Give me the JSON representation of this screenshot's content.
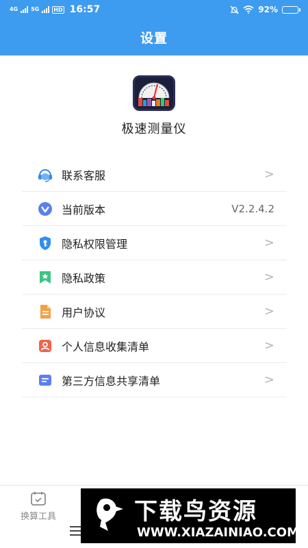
{
  "status_bar": {
    "sig1": "4G",
    "sig2": "5G",
    "hd": "HD",
    "time": "16:57",
    "battery_text": "92%",
    "battery_level": 0.92
  },
  "header": {
    "title": "设置"
  },
  "app": {
    "name": "极速测量仪"
  },
  "menu": {
    "items": [
      {
        "label": "联系客服",
        "icon": "headset-icon",
        "color": "#3a86e8"
      },
      {
        "label": "当前版本",
        "icon": "version-v-icon",
        "color": "#5b7ff0",
        "value": "V2.2.4.2"
      },
      {
        "label": "隐私权限管理",
        "icon": "shield-key-icon",
        "color": "#2f8ff0"
      },
      {
        "label": "隐私政策",
        "icon": "bookmark-star-icon",
        "color": "#3cc483"
      },
      {
        "label": "用户协议",
        "icon": "document-icon",
        "color": "#f5a142"
      },
      {
        "label": "个人信息收集清单",
        "icon": "person-card-icon",
        "color": "#f2624d"
      },
      {
        "label": "第三方信息共享清单",
        "icon": "share-list-icon",
        "color": "#5b7ff0"
      }
    ]
  },
  "bottom_nav": {
    "tools_label": "换算工具"
  },
  "watermark": {
    "title": "下载鸟资源",
    "url": "WWW.XIAZAINIAO.COM"
  },
  "colors": {
    "primary": "#3d9bf0",
    "divider": "#ececec"
  }
}
